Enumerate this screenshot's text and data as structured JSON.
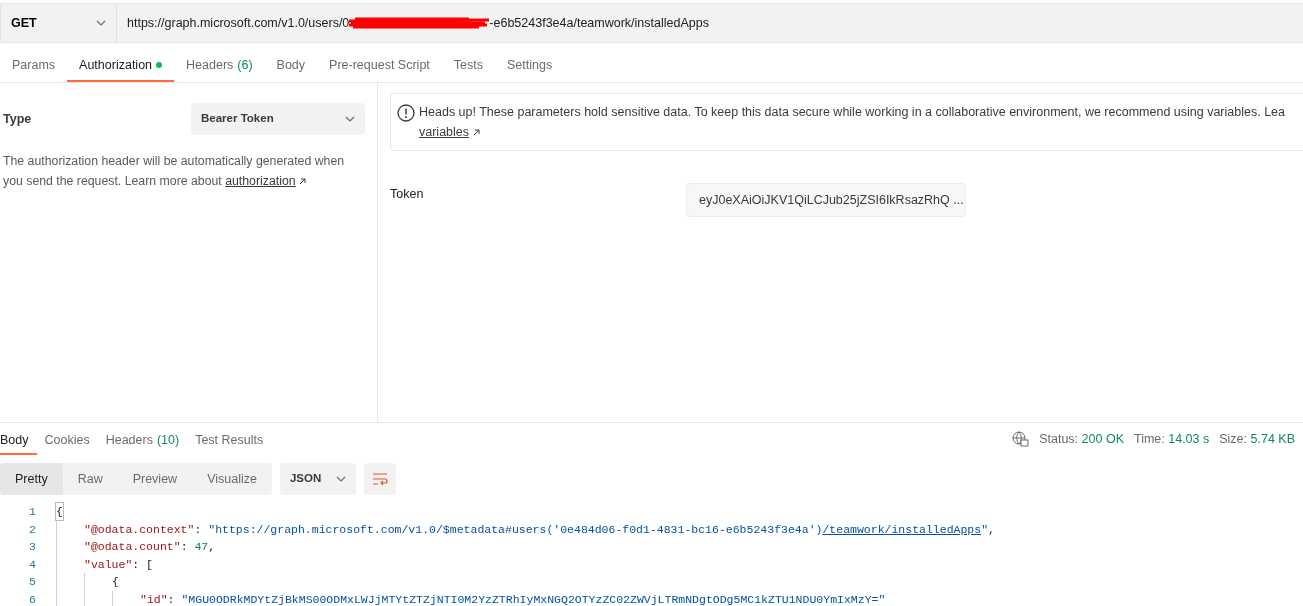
{
  "request": {
    "method": "GET",
    "url_before": "https://graph.microsoft.com/v1.0/users/0",
    "url_after": "-e6b5243f3e4a/teamwork/installedApps"
  },
  "request_tabs": [
    {
      "label": "Params",
      "selected": false
    },
    {
      "label": "Authorization",
      "selected": true,
      "dot": true
    },
    {
      "label": "Headers",
      "count": "(6)",
      "selected": false
    },
    {
      "label": "Body",
      "selected": false
    },
    {
      "label": "Pre-request Script",
      "selected": false
    },
    {
      "label": "Tests",
      "selected": false
    },
    {
      "label": "Settings",
      "selected": false
    }
  ],
  "auth": {
    "type_label": "Type",
    "type_value": "Bearer Token",
    "description": "The authorization header will be automatically generated when you send the request. Learn more about",
    "description_link": "authorization",
    "notice": "Heads up! These parameters hold sensitive data. To keep this data secure while working in a collaborative environment, we recommend using variables. Lea",
    "notice_link": "variables",
    "token_label": "Token",
    "token_value": "eyJ0eXAiOiJKV1QiLCJub25jZSI6IkRsazRhQ ..."
  },
  "response_tabs": [
    {
      "label": "Body",
      "selected": true
    },
    {
      "label": "Cookies",
      "selected": false
    },
    {
      "label": "Headers",
      "count": "(10)",
      "selected": false
    },
    {
      "label": "Test Results",
      "selected": false
    }
  ],
  "status": [
    {
      "label": "Status:",
      "value": "200 OK"
    },
    {
      "label": "Time:",
      "value": "14.03 s"
    },
    {
      "label": "Size:",
      "value": "5.74 KB"
    }
  ],
  "view_modes": [
    {
      "label": "Pretty",
      "selected": true
    },
    {
      "label": "Raw",
      "selected": false
    },
    {
      "label": "Preview",
      "selected": false
    },
    {
      "label": "Visualize",
      "selected": false
    }
  ],
  "format": "JSON",
  "code_lines": [
    {
      "number": "1",
      "tokens": [
        {
          "kind": "bracket",
          "text": "{"
        }
      ]
    },
    {
      "number": "2",
      "tokens": [
        {
          "kind": "key",
          "text": "\"@odata.context\""
        },
        {
          "kind": "punct",
          "text": ": "
        },
        {
          "kind": "string",
          "text": "\"https://graph.microsoft.com/v1.0/$metadata#users('0e484d06-f0d1-4831-bc16-e6b5243f3e4a')"
        },
        {
          "kind": "link",
          "text": "/teamwork/installedApps"
        },
        {
          "kind": "string",
          "text": "\""
        },
        {
          "kind": "punct",
          "text": ","
        }
      ]
    },
    {
      "number": "3",
      "tokens": [
        {
          "kind": "key",
          "text": "\"@odata.count\""
        },
        {
          "kind": "punct",
          "text": ": "
        },
        {
          "kind": "number",
          "text": "47"
        },
        {
          "kind": "punct",
          "text": ","
        }
      ]
    },
    {
      "number": "4",
      "tokens": [
        {
          "kind": "key",
          "text": "\"value\""
        },
        {
          "kind": "punct",
          "text": ": ["
        }
      ]
    },
    {
      "number": "5",
      "tokens": [
        {
          "kind": "punct",
          "text": "{"
        }
      ]
    },
    {
      "number": "6",
      "tokens": [
        {
          "kind": "key",
          "text": "\"id\""
        },
        {
          "kind": "punct",
          "text": ": "
        },
        {
          "kind": "string",
          "text": "\"MGU0ODRkMDYtZjBkMS00ODMxLWJjMTYtZTZjNTI0M2YzZTRhIyMxNGQ2OTYzZC02ZWVjLTRmNDgtODg5MC1kZTU1NDU0YmIxMzY=\""
        }
      ]
    }
  ]
}
